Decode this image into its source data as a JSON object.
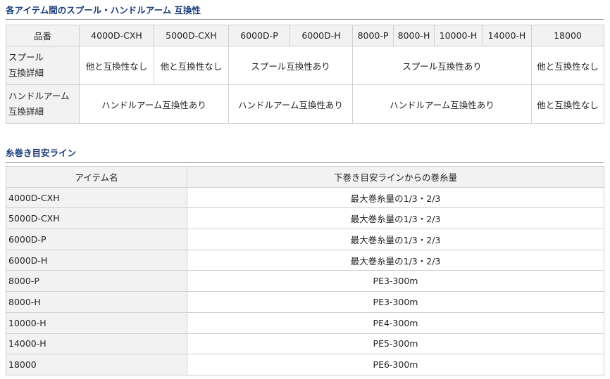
{
  "compat_section": {
    "title": "各アイテム間のスプール・ハンドルアーム 互換性",
    "header_label": "品番",
    "models": [
      "4000D-CXH",
      "5000D-CXH",
      "6000D-P",
      "6000D-H",
      "8000-P",
      "8000-H",
      "10000-H",
      "14000-H",
      "18000"
    ],
    "spool_row": {
      "label_line1": "スプール",
      "label_line2": "互換詳細",
      "cells": [
        "他と互換性なし",
        "他と互換性なし",
        "スプール互換性あり",
        "スプール互換性あり",
        "他と互換性なし"
      ]
    },
    "handle_row": {
      "label_line1": "ハンドルアーム",
      "label_line2": "互換詳細",
      "cells": [
        "ハンドルアーム互換性あり",
        "ハンドルアーム互換性あり",
        "ハンドルアーム互換性あり",
        "他と互換性なし"
      ]
    }
  },
  "line_section": {
    "title": "糸巻き目安ライン",
    "col_item": "アイテム名",
    "col_amount": "下巻き目安ラインからの巻糸量",
    "rows": [
      {
        "item": "4000D-CXH",
        "amount": "最大巻糸量の1/3・2/3"
      },
      {
        "item": "5000D-CXH",
        "amount": "最大巻糸量の1/3・2/3"
      },
      {
        "item": "6000D-P",
        "amount": "最大巻糸量の1/3・2/3"
      },
      {
        "item": "6000D-H",
        "amount": "最大巻糸量の1/3・2/3"
      },
      {
        "item": "8000-P",
        "amount": "PE3-300m"
      },
      {
        "item": "8000-H",
        "amount": "PE3-300m"
      },
      {
        "item": "10000-H",
        "amount": "PE4-300m"
      },
      {
        "item": "14000-H",
        "amount": "PE5-300m"
      },
      {
        "item": "18000",
        "amount": "PE6-300m"
      }
    ]
  },
  "colors": {
    "title": "#1a3a7a",
    "header_bg": "#f2f2f2",
    "border": "#cfcfcf"
  }
}
